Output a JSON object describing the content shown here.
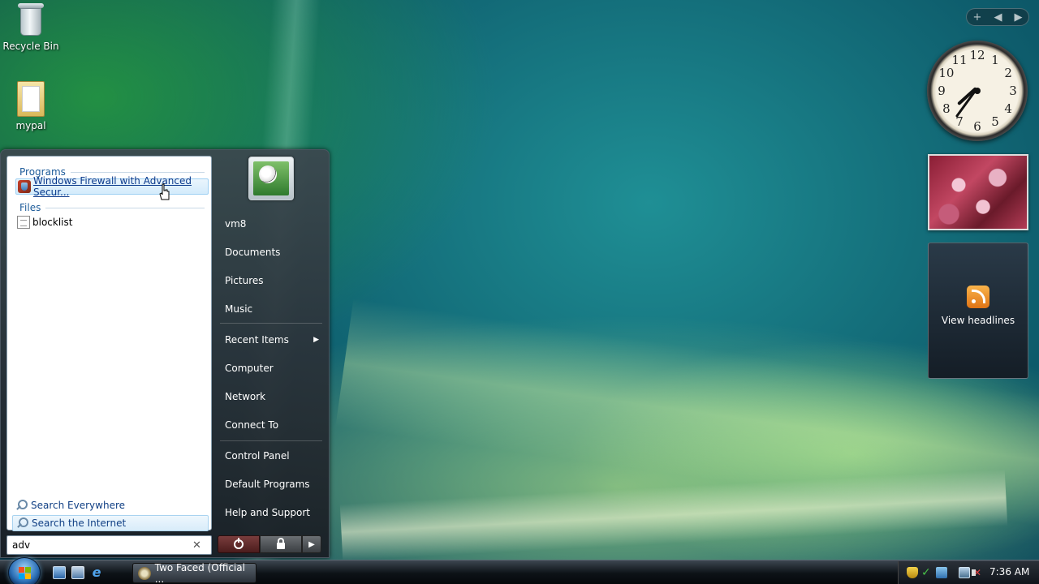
{
  "desktop": {
    "icons": [
      {
        "label": "Recycle Bin",
        "icon": "recycle-bin-icon"
      },
      {
        "label": "mypal",
        "icon": "folder-icon"
      }
    ]
  },
  "sidebar": {
    "controls": {
      "add": "+",
      "prev": "◀",
      "next": "▶"
    },
    "clock": {
      "numbers": [
        "12",
        "1",
        "2",
        "3",
        "4",
        "5",
        "6",
        "7",
        "8",
        "9",
        "10",
        "11"
      ],
      "time": "7:36"
    },
    "feed": {
      "label": "View headlines",
      "icon": "rss-icon"
    }
  },
  "start_menu": {
    "left": {
      "programs_header": "Programs",
      "files_header": "Files",
      "programs": [
        {
          "label": "Windows Firewall with Advanced Secur...",
          "icon": "firewall-icon",
          "selected": true
        }
      ],
      "files": [
        {
          "label": "blocklist",
          "icon": "document-icon"
        }
      ],
      "search_everywhere": "Search Everywhere",
      "search_internet": "Search the Internet",
      "search_value": "adv",
      "search_clear": "✕"
    },
    "right": {
      "items": [
        "vm8",
        "Documents",
        "Pictures",
        "Music",
        "Recent Items",
        "Computer",
        "Network",
        "Connect To",
        "Control Panel",
        "Default Programs",
        "Help and Support"
      ],
      "recent_arrow": "▶"
    },
    "power": {
      "more": "▶"
    }
  },
  "taskbar": {
    "task_button": "Two Faced (Official ...",
    "time": "7:36 AM"
  },
  "colors": {
    "link": "#103f84",
    "section_header": "#1e5c9a",
    "power_button": "#7a3d3d"
  }
}
